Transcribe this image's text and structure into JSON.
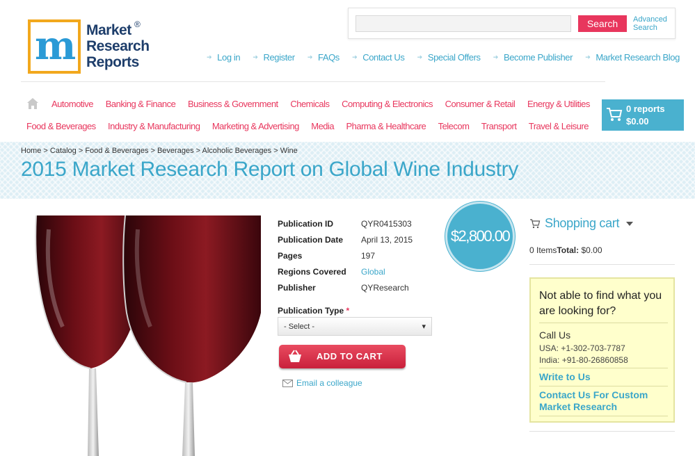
{
  "logo": {
    "lines": [
      "Market",
      "Research",
      "Reports"
    ],
    "registered": "®"
  },
  "search": {
    "placeholder": "",
    "button": "Search",
    "advanced_line1": "Advanced",
    "advanced_line2": "Search"
  },
  "top_links": [
    "Log in",
    "Register",
    "FAQs",
    "Contact Us",
    "Special Offers",
    "Become Publisher",
    "Market Research Blog"
  ],
  "categories_row1": [
    "Automotive",
    "Banking & Finance",
    "Business & Government",
    "Chemicals",
    "Computing & Electronics",
    "Consumer & Retail",
    "Energy & Utilities"
  ],
  "categories_row2": [
    "Food & Beverages",
    "Industry & Manufacturing",
    "Marketing & Advertising",
    "Media",
    "Pharma & Healthcare",
    "Telecom",
    "Transport",
    "Travel & Leisure"
  ],
  "cart_button": {
    "count": "0 reports",
    "total": "$0.00"
  },
  "breadcrumb": "Home > Catalog > Food & Beverages > Beverages > Alcoholic Beverages > Wine",
  "page_title": "2015 Market Research Report on Global Wine Industry",
  "details": [
    {
      "label": "Publication ID",
      "value": "QYR0415303",
      "link": false
    },
    {
      "label": "Publication Date",
      "value": "April 13, 2015",
      "link": false
    },
    {
      "label": "Pages",
      "value": "197",
      "link": false
    },
    {
      "label": "Regions Covered",
      "value": "Global",
      "link": true
    },
    {
      "label": "Publisher",
      "value": "QYResearch",
      "link": false
    }
  ],
  "price": "$2,800.00",
  "publication_type": {
    "label": "Publication Type",
    "required_mark": "*",
    "selected": "- Select -"
  },
  "add_to_cart": "ADD TO CART",
  "email_colleague": "Email a colleague",
  "shopping_cart": {
    "heading": "Shopping cart",
    "items": "0 Items",
    "total_label": "Total:",
    "total_value": "$0.00"
  },
  "help": {
    "heading": "Not able to find what you are looking for?",
    "call_us": "Call Us",
    "phone_usa": "USA: +1-302-703-7787",
    "phone_india": "India: +91-80-26860858",
    "write_to_us": "Write to Us",
    "contact_custom": "Contact Us For Custom Market Research"
  },
  "colors": {
    "accent_blue": "#3aa6c9",
    "accent_pink": "#e8365d",
    "cart_blue": "#4ab1cf",
    "help_bg": "#ffffcc"
  }
}
